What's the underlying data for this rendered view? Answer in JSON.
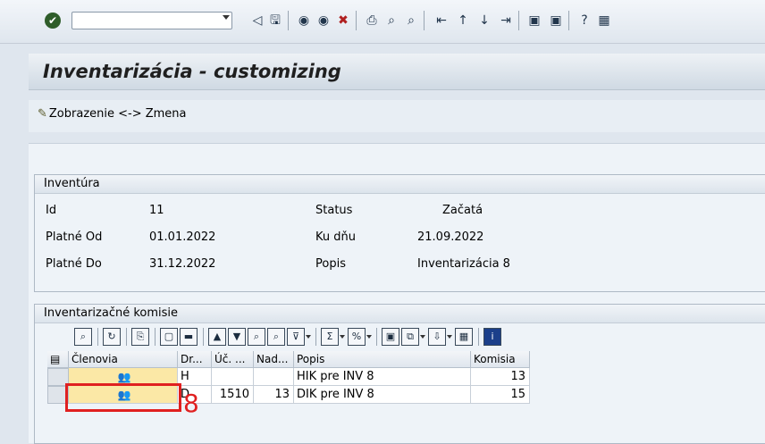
{
  "toolbar": {
    "command_field_value": "",
    "icons": [
      "enter-icon",
      "back-icon",
      "save-icon",
      "nav-back-icon",
      "nav-exit-icon",
      "nav-cancel-icon",
      "print-icon",
      "find-icon",
      "find-next-icon",
      "first-page-icon",
      "prev-page-icon",
      "next-page-icon",
      "last-page-icon",
      "create-session-icon",
      "shortcut-icon",
      "help-icon",
      "layout-icon"
    ]
  },
  "title": "Inventarizácia - customizing",
  "app_toolbar": {
    "toggle_label": "Zobrazenie <-> Zmena"
  },
  "inventura": {
    "group_title": "Inventúra",
    "id_label": "Id",
    "id_value": "11",
    "platne_od_label": "Platné Od",
    "platne_od_value": "01.01.2022",
    "platne_do_label": "Platné Do",
    "platne_do_value": "31.12.2022",
    "status_label": "Status",
    "status_value": "Začatá",
    "ku_dnu_label": "Ku dňu",
    "ku_dnu_value": "21.09.2022",
    "popis_label": "Popis",
    "popis_value": "Inventarizácia 8"
  },
  "komisie": {
    "group_title": "Inventarizačné komisie",
    "columns": [
      "Členovia",
      "Dr...",
      "Úč. ...",
      "Nad...",
      "Popis",
      "Komisia"
    ],
    "rows": [
      {
        "dr": "H",
        "uc": "",
        "nad": "",
        "popis": "HIK pre INV 8",
        "komisia": "13"
      },
      {
        "dr": "D",
        "uc": "1510",
        "nad": "13",
        "popis": "DIK pre INV 8",
        "komisia": "15"
      }
    ]
  },
  "annotation": {
    "label": "8",
    "color": "#e02020"
  }
}
